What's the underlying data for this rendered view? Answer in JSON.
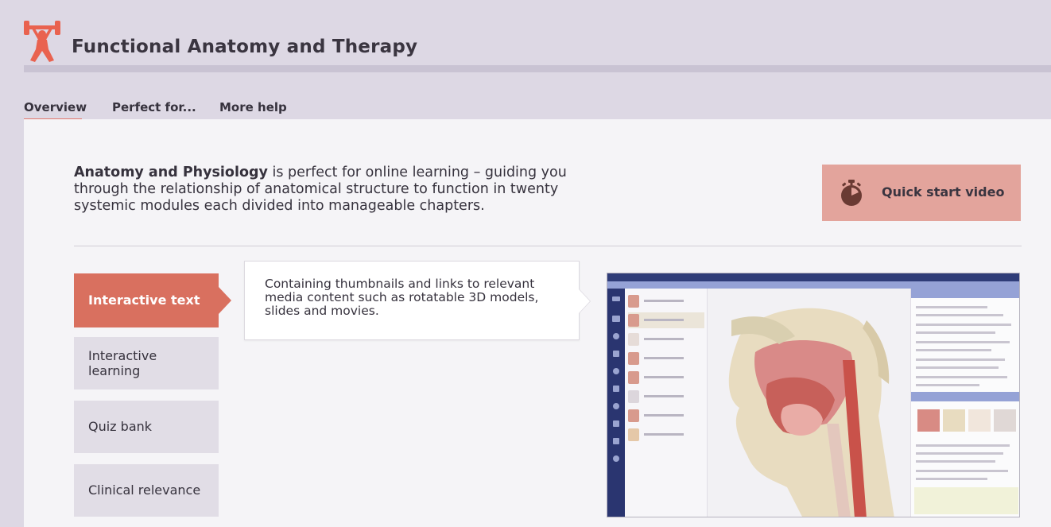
{
  "app": {
    "title": "Functional Anatomy and Therapy",
    "logo_icon": "weightlifter-icon"
  },
  "tabs": [
    {
      "label": "Overview",
      "active": true
    },
    {
      "label": "Perfect for...",
      "active": false
    },
    {
      "label": "More help",
      "active": false
    }
  ],
  "intro": {
    "bold": "Anatomy and Physiology",
    "rest": " is perfect for online learning – guiding you through the relationship of anatomical structure to function in twenty systemic modules each divided into manageable chapters."
  },
  "quick_start": {
    "label": "Quick start video",
    "icon": "stopwatch-icon"
  },
  "features": [
    {
      "label": "Interactive text",
      "active": true
    },
    {
      "label": "Interactive learning",
      "active": false
    },
    {
      "label": "Quiz bank",
      "active": false
    },
    {
      "label": "Clinical relevance",
      "active": false
    }
  ],
  "callout": {
    "text": "Containing thumbnails and links to relevant media content such as rotatable 3D models, slides and movies."
  },
  "preview": {
    "icon": "app-screenshot-thumbnail"
  },
  "colors": {
    "accent": "#e2786e",
    "active_feature": "#d9705f",
    "button": "#e3a49c",
    "header_bg": "#ddd8e4",
    "panel_bg": "#f5f4f7",
    "nav_blue": "#2f3c78"
  }
}
